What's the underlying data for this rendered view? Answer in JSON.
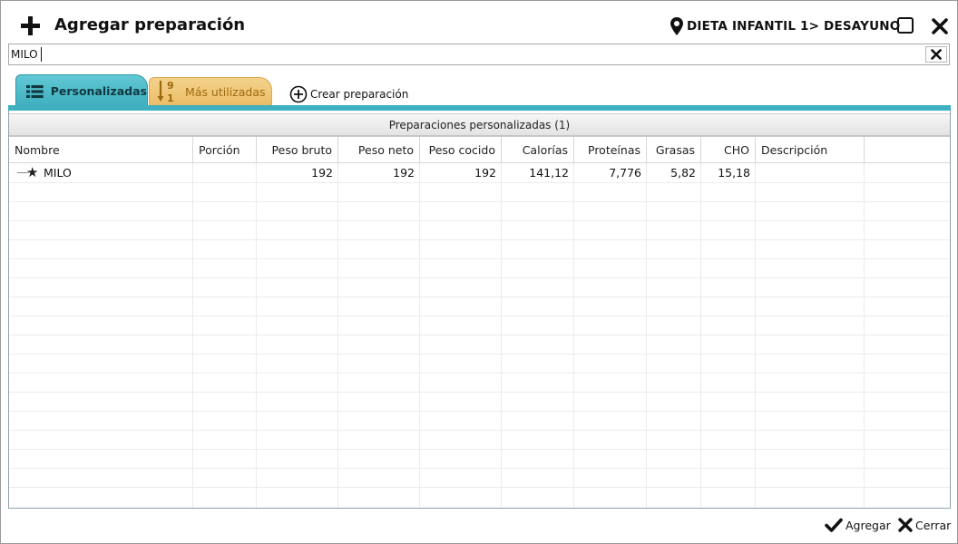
{
  "header": {
    "title": "Agregar preparación",
    "location": "DIETA INFANTIL 1> DESAYUNO"
  },
  "search": {
    "value": "MILO",
    "placeholder": ""
  },
  "tabs": [
    {
      "label": "Personalizadas",
      "icon": "list-icon",
      "active": true
    },
    {
      "label": "Más utilizadas",
      "icon": "sort-numeric-desc-icon",
      "active": false
    }
  ],
  "create_action": {
    "label": "Crear preparación",
    "icon": "plus-circle-icon"
  },
  "grid": {
    "group_title": "Preparaciones personalizadas (1)",
    "columns": [
      "Nombre",
      "Porción",
      "Peso bruto",
      "Peso neto",
      "Peso cocido",
      "Calorías",
      "Proteínas",
      "Grasas",
      "CHO",
      "Descripción"
    ],
    "rows": [
      {
        "nombre": "MILO",
        "porcion": "",
        "peso_bruto": "192",
        "peso_neto": "192",
        "peso_cocido": "192",
        "calorias": "141,12",
        "proteinas": "7,776",
        "grasas": "5,82",
        "cho": "15,18",
        "descripcion": "",
        "icon": "star-icon"
      }
    ]
  },
  "footer": {
    "agregar_label": "Agregar",
    "cerrar_label": "Cerrar"
  },
  "colors": {
    "tab_active": "#4bbac9",
    "tab_inactive": "#f0c878",
    "tab_inactive_text": "#9b6a10"
  }
}
